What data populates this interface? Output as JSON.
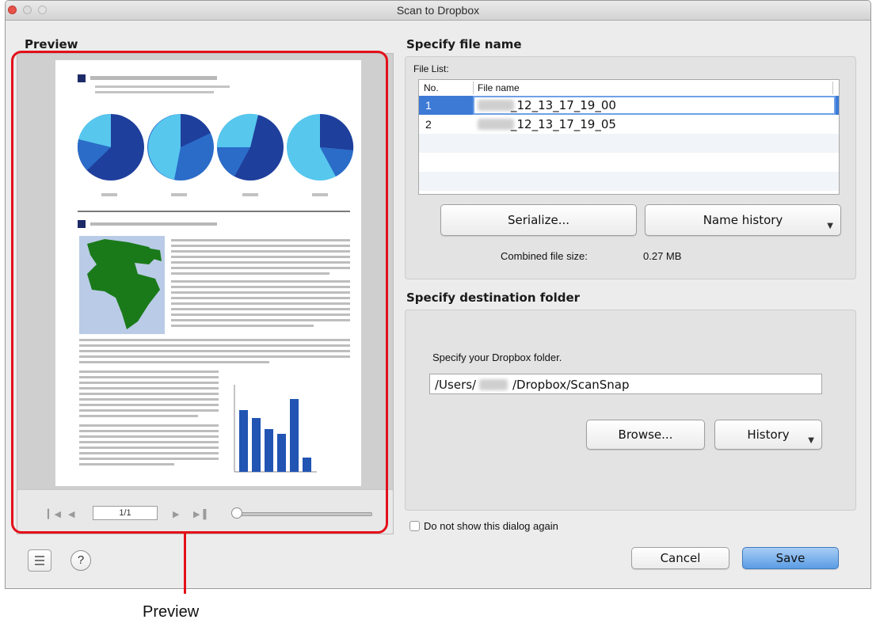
{
  "window": {
    "title": "Scan to Dropbox"
  },
  "preview": {
    "heading": "Preview",
    "page_indicator": "1/1",
    "callout": "Preview",
    "zoom": 0.0,
    "icons": [
      "first-page-icon",
      "previous-page-icon",
      "next-page-icon",
      "last-page-icon"
    ]
  },
  "file_section": {
    "heading": "Specify file name",
    "list_label": "File List:",
    "columns": [
      "No.",
      "File name"
    ],
    "rows": [
      {
        "no": "1",
        "name": "_12_13_17_19_00",
        "selected": true
      },
      {
        "no": "2",
        "name": "_12_13_17_19_05",
        "selected": false
      }
    ],
    "serialize_button": "Serialize...",
    "name_history_button": "Name history",
    "combined_size_label": "Combined file size:",
    "combined_size_value": "0.27  MB"
  },
  "destination_section": {
    "heading": "Specify destination folder",
    "instruction": "Specify your Dropbox folder.",
    "path_prefix": "/Users/",
    "path_suffix": "/Dropbox/ScanSnap",
    "browse_button": "Browse...",
    "history_button": "History"
  },
  "dont_show_again": "Do not show this dialog again",
  "cancel_button": "Cancel",
  "save_button": "Save",
  "colors": {
    "highlight": "#e4101a",
    "selection": "#3d7ad6",
    "save": "#5b9ce4"
  }
}
